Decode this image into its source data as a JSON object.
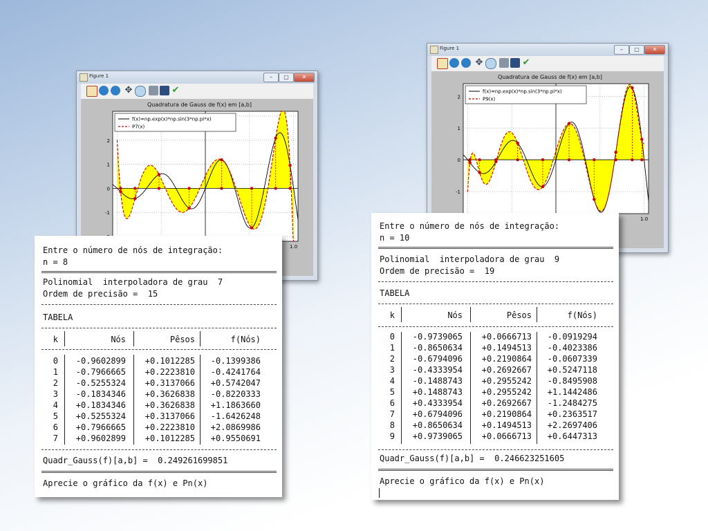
{
  "left": {
    "window_title": "Figure 1",
    "chart_data": {
      "type": "line",
      "title": "Quadratura de Gauss de f(x) em [a,b]",
      "x_range": [
        -1.05,
        1.05
      ],
      "ylim": [
        -2.2,
        3.2
      ],
      "yticks": [
        "2",
        "1",
        "0",
        "-1",
        "-2"
      ],
      "xtick_visible": "1.0",
      "grid": true,
      "legend_position": "top-left",
      "series": [
        {
          "name": "f(x)=np.exp(x)*np.sin(3*np.pi*x)",
          "color": "#000000",
          "style": "solid"
        },
        {
          "name": "P7(x)",
          "color": "#cc0000",
          "style": "dashed"
        }
      ],
      "fill_color": "#ffff00",
      "nodes": [
        -0.9602899,
        -0.7966665,
        -0.5255324,
        -0.1834346,
        0.1834346,
        0.5255324,
        0.7966665,
        0.9602899
      ],
      "fvals": [
        -0.1399386,
        -0.4241764,
        0.5742047,
        -0.8220333,
        1.186366,
        -1.6426248,
        2.0869986,
        0.9550691
      ]
    },
    "console": {
      "prompt": "Entre o número de nós de integração:",
      "n_line": "n = 8",
      "poly_line": "Polinomial  interpoladora de grau  7",
      "order_line": "Ordem de precisão =  15",
      "table_label": "TABELA",
      "headers": [
        "k",
        "Nós",
        "Pêsos",
        "f(Nós)"
      ],
      "rows": [
        [
          "0",
          "-0.9602899",
          "+0.1012285",
          "-0.1399386"
        ],
        [
          "1",
          "-0.7966665",
          "+0.2223810",
          "-0.4241764"
        ],
        [
          "2",
          "-0.5255324",
          "+0.3137066",
          "+0.5742047"
        ],
        [
          "3",
          "-0.1834346",
          "+0.3626838",
          "-0.8220333"
        ],
        [
          "4",
          "+0.1834346",
          "+0.3626838",
          "+1.1863660"
        ],
        [
          "5",
          "+0.5255324",
          "+0.3137066",
          "-1.6426248"
        ],
        [
          "6",
          "+0.7966665",
          "+0.2223810",
          "+2.0869986"
        ],
        [
          "7",
          "+0.9602899",
          "+0.1012285",
          "+0.9550691"
        ]
      ],
      "result": "Quadr_Gauss(f)[a,b] =  0.249261699851",
      "closing": "Aprecie o gráfico da f(x) e Pn(x)"
    }
  },
  "right": {
    "window_title": "Figure 1",
    "chart_data": {
      "type": "line",
      "title": "Quadratura de Gauss de f(x) em [a,b]",
      "x_range": [
        -1.05,
        1.05
      ],
      "ylim": [
        -1.7,
        2.4
      ],
      "yticks": [
        "2",
        "1",
        "0",
        "-1"
      ],
      "xtick_visible": "1.0",
      "grid": true,
      "legend_position": "top-left",
      "series": [
        {
          "name": "f(x)=np.exp(x)*np.sin(3*np.pi*x)",
          "color": "#000000",
          "style": "solid"
        },
        {
          "name": "P9(x)",
          "color": "#cc0000",
          "style": "dashed"
        }
      ],
      "fill_color": "#ffff00",
      "nodes": [
        -0.9739065,
        -0.8650634,
        -0.6794096,
        -0.4333954,
        -0.1488743,
        0.1488743,
        0.4333954,
        0.6794096,
        0.8650634,
        0.9739065
      ],
      "fvals": [
        -0.0919294,
        -0.4023386,
        -0.0607339,
        0.5247118,
        -0.8495908,
        1.1442486,
        -1.2484275,
        0.2363517,
        2.2697406,
        0.6447313
      ]
    },
    "console": {
      "prompt": "Entre o número de nós de integração:",
      "n_line": "n = 10",
      "poly_line": "Polinomial  interpoladora de grau  9",
      "order_line": "Ordem de precisão =  19",
      "table_label": "TABELA",
      "headers": [
        "k",
        "Nós",
        "Pêsos",
        "f(Nós)"
      ],
      "rows": [
        [
          "0",
          "-0.9739065",
          "+0.0666713",
          "-0.0919294"
        ],
        [
          "1",
          "-0.8650634",
          "+0.1494513",
          "-0.4023386"
        ],
        [
          "2",
          "-0.6794096",
          "+0.2190864",
          "-0.0607339"
        ],
        [
          "3",
          "-0.4333954",
          "+0.2692667",
          "+0.5247118"
        ],
        [
          "4",
          "-0.1488743",
          "+0.2955242",
          "-0.8495908"
        ],
        [
          "5",
          "+0.1488743",
          "+0.2955242",
          "+1.1442486"
        ],
        [
          "6",
          "+0.4333954",
          "+0.2692667",
          "-1.2484275"
        ],
        [
          "7",
          "+0.6794096",
          "+0.2190864",
          "+0.2363517"
        ],
        [
          "8",
          "+0.8650634",
          "+0.1494513",
          "+2.2697406"
        ],
        [
          "9",
          "+0.9739065",
          "+0.0666713",
          "+0.6447313"
        ]
      ],
      "result": "Quadr_Gauss(f)[a,b] =  0.246623251605",
      "closing": "Aprecie o gráfico da f(x) e Pn(x)"
    }
  }
}
